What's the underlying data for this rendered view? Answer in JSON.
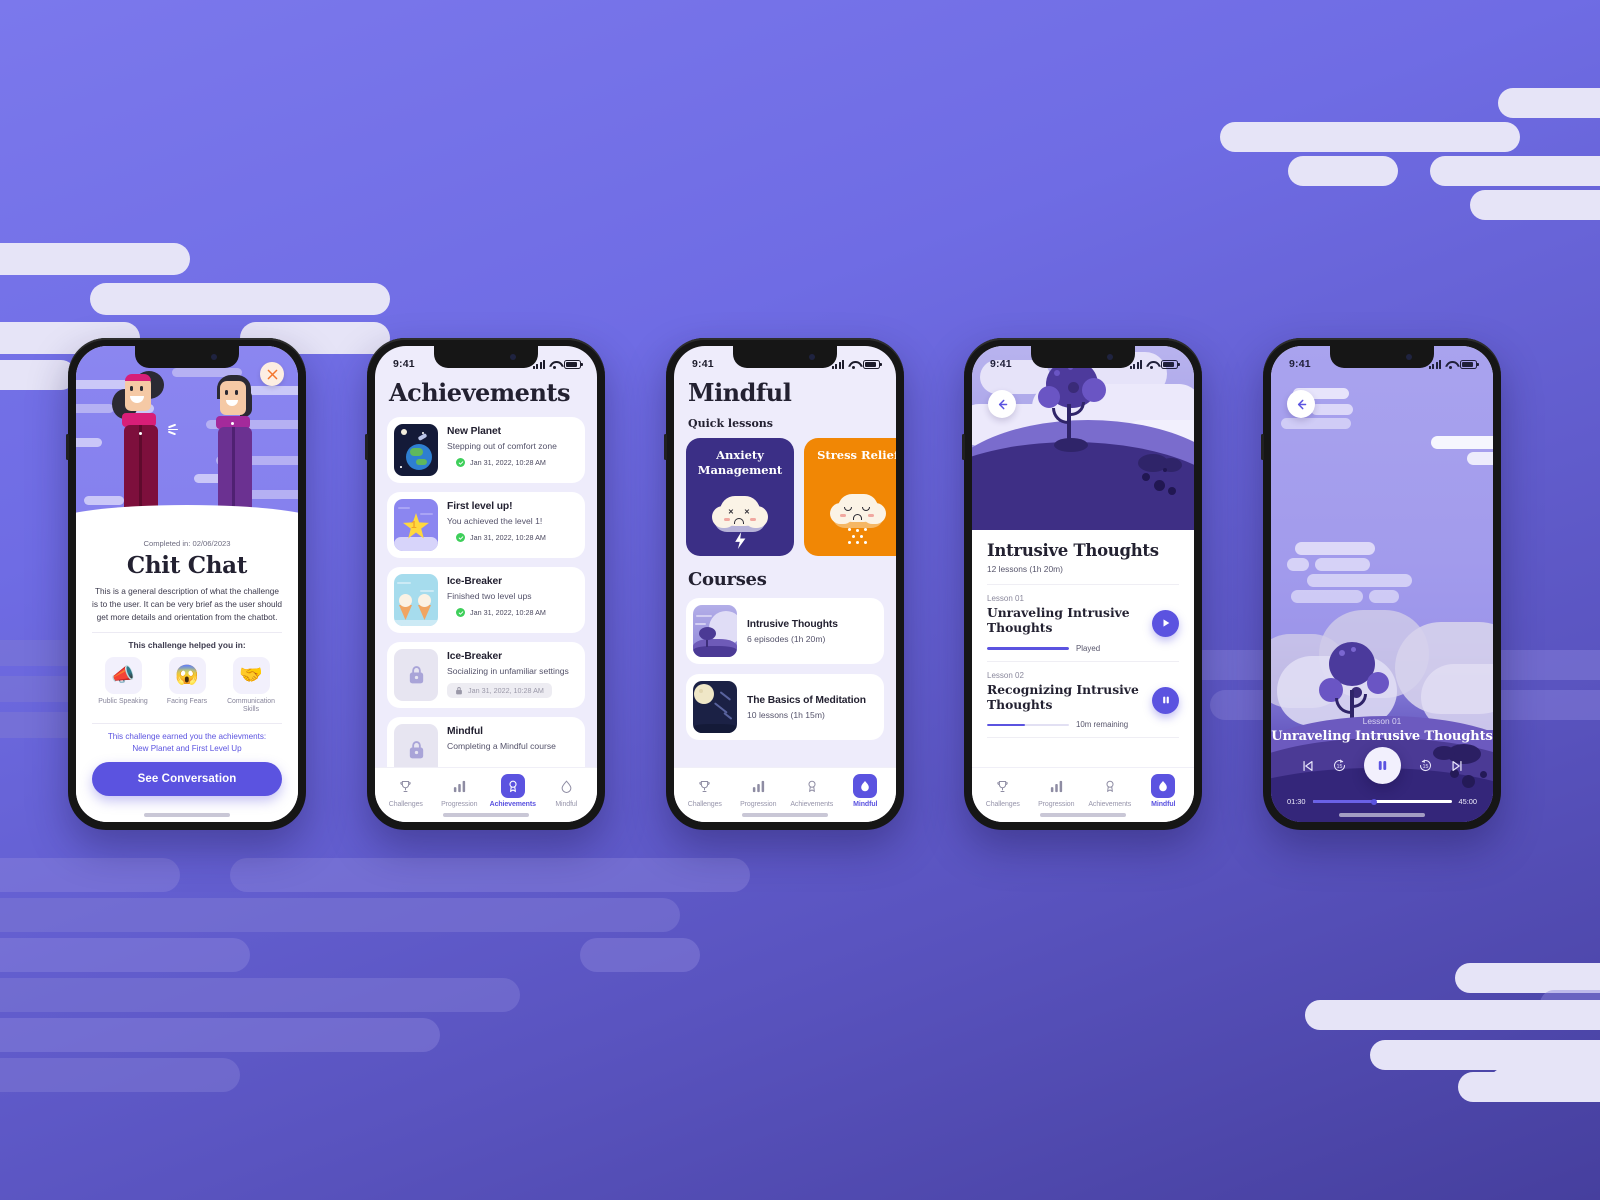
{
  "theme": {
    "bg_gradient_from": "#7b78ec",
    "bg_gradient_to": "#463f9e",
    "accent": "#5b53e0",
    "orange": "#f18705",
    "deep_purple": "#3b2f86",
    "success_green": "#3ecf5a"
  },
  "status_bar": {
    "time": "9:41"
  },
  "tabs": [
    {
      "label": "Challenges",
      "icon": "trophy-icon"
    },
    {
      "label": "Progression",
      "icon": "bar-chart-icon"
    },
    {
      "label": "Achievements",
      "icon": "award-badge-icon"
    },
    {
      "label": "Mindful",
      "icon": "leaf-icon"
    }
  ],
  "screen1": {
    "close_icon": "close-icon",
    "completed_label": "Completed in: 02/06/2023",
    "title": "Chit Chat",
    "description": "This is a general description of what the challenge is to the user. It can be very brief as the user should get more details and orientation from the chatbot.",
    "helped_label": "This challenge helped you in:",
    "skills": [
      {
        "label": "Public Speaking",
        "icon": "megaphone-icon",
        "glyph": "📣"
      },
      {
        "label": "Facing Fears",
        "icon": "scream-face-icon",
        "glyph": "😱"
      },
      {
        "label": "Communication Skills",
        "icon": "handshake-icon",
        "glyph": "🤝"
      }
    ],
    "earned_line1": "This challenge earned you the achievments:",
    "earned_line2": "New Planet and First Level Up",
    "cta_label": "See Conversation",
    "active_tab": -1
  },
  "screen2": {
    "title": "Achievements",
    "active_tab": 2,
    "achievements": [
      {
        "name": "New Planet",
        "subtitle": "Stepping out of comfort zone",
        "date": "Jan 31, 2022, 10:28 AM",
        "locked": false,
        "thumb": "planet-thumb"
      },
      {
        "name": "First level up!",
        "subtitle": "You achieved the level 1!",
        "date": "Jan 31, 2022, 10:28 AM",
        "locked": false,
        "thumb": "star-level-thumb"
      },
      {
        "name": "Ice-Breaker",
        "subtitle": "Finished two level ups",
        "date": "Jan 31, 2022, 10:28 AM",
        "locked": false,
        "thumb": "ice-cream-thumb"
      },
      {
        "name": "Ice-Breaker",
        "subtitle": "Socializing in unfamiliar settings",
        "date": "Jan 31, 2022, 10:28 AM",
        "locked": true,
        "thumb": "lock-thumb"
      },
      {
        "name": "Mindful",
        "subtitle": "Completing a Mindful course",
        "date": "",
        "locked": true,
        "thumb": "lock-thumb"
      }
    ]
  },
  "screen3": {
    "title": "Mindful",
    "active_tab": 3,
    "quick_heading": "Quick lessons",
    "quick_lessons": [
      {
        "title": "Anxiety Management",
        "icon": "storm-cloud-icon",
        "color": "#3b2f86"
      },
      {
        "title": "Stress Relief",
        "icon": "rain-cloud-icon",
        "color": "#f18705"
      }
    ],
    "courses_heading": "Courses",
    "courses": [
      {
        "name": "Intrusive Thoughts",
        "meta": "6 episodes (1h 20m)",
        "thumb": "tree-hill-thumb"
      },
      {
        "name": "The Basics of Meditation",
        "meta": "10 lessons (1h 15m)",
        "thumb": "moon-night-thumb"
      }
    ]
  },
  "screen4": {
    "back_icon": "back-arrow-icon",
    "active_tab": 3,
    "course_title": "Intrusive Thoughts",
    "course_meta": "12 lessons (1h 20m)",
    "lessons": [
      {
        "number": "Lesson 01",
        "title": "Unraveling Intrusive Thoughts",
        "progress_label": "Played",
        "progress_pct": 100,
        "action_icon": "play-icon"
      },
      {
        "number": "Lesson 02",
        "title": "Recognizing Intrusive Thoughts",
        "progress_label": "10m remaining",
        "progress_pct": 46,
        "action_icon": "pause-icon"
      }
    ]
  },
  "screen5": {
    "back_icon": "back-arrow-icon",
    "lesson_number": "Lesson 01",
    "lesson_title": "Unraveling Intrusive Thoughts",
    "current_time": "01:30",
    "total_time": "45:00",
    "progress_pct": 44,
    "controls": [
      {
        "name": "previous-track-button",
        "icon": "skip-back-icon"
      },
      {
        "name": "rewind-15-button",
        "icon": "rewind-15-icon",
        "label": "15"
      },
      {
        "name": "play-pause-button",
        "icon": "pause-icon"
      },
      {
        "name": "forward-15-button",
        "icon": "forward-15-icon",
        "label": "15"
      },
      {
        "name": "next-track-button",
        "icon": "skip-forward-icon"
      }
    ]
  }
}
